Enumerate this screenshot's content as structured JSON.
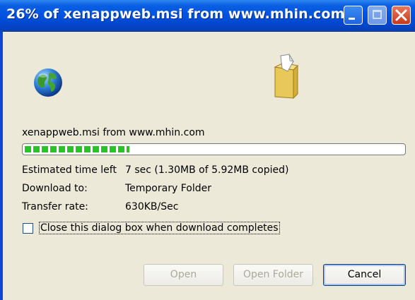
{
  "window": {
    "title": "26% of xenappweb.msi from www.mhin.com...",
    "controls": [
      "minimize",
      "maximize",
      "close"
    ]
  },
  "icons": {
    "source": "globe-icon",
    "destination": "folder-icon"
  },
  "download": {
    "source_label": "xenappweb.msi from www.mhin.com",
    "progress_fraction": 0.26
  },
  "details": {
    "time_left_label": "Estimated time left",
    "time_left_value": "7 sec (1.30MB of 5.92MB copied)",
    "download_to_label": "Download to:",
    "download_to_value": "Temporary Folder",
    "transfer_rate_label": "Transfer rate:",
    "transfer_rate_value": "630KB/Sec"
  },
  "options": {
    "close_when_complete_label": "Close this dialog box when download completes",
    "close_when_complete_checked": false
  },
  "buttons": {
    "open": "Open",
    "open_folder": "Open Folder",
    "cancel": "Cancel"
  }
}
